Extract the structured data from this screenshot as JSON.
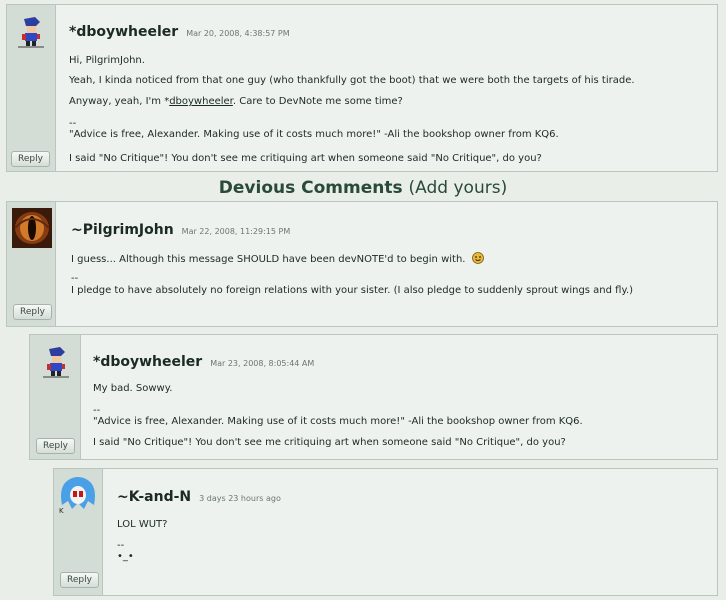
{
  "section_title": "Devious Comments",
  "section_add": "(Add yours)",
  "comments": [
    {
      "author": "*dboywheeler",
      "date": "Mar 20, 2008, 4:38:57 PM",
      "lines": [
        "Hi, PilgrimJohn.",
        "Yeah, I kinda noticed from that one guy (who thankfully got the boot) that we were both the targets of his tirade.",
        "Anyway, yeah, I'm *",
        "dboywheeler",
        ". Care to DevNote me some time?"
      ],
      "sig_sep": "--",
      "sig1": "\"Advice is free, Alexander. Making use of it costs much more!\" -Ali the bookshop owner from KQ6.",
      "sig2": "I said \"No Critique\"! You don't see me critiquing art when someone said \"No Critique\", do you?",
      "reply": "Reply"
    },
    {
      "author": "~PilgrimJohn",
      "date": "Mar 22, 2008, 11:29:15 PM",
      "line1": "I guess... Although this message SHOULD have been devNOTE'd to begin with.",
      "sig_sep": "--",
      "sig1": "I pledge to have absolutely no foreign relations with your sister. (I also pledge to suddenly sprout wings and fly.)",
      "reply": "Reply"
    },
    {
      "author": "*dboywheeler",
      "date": "Mar 23, 2008, 8:05:44 AM",
      "line1": "My bad. Sowwy.",
      "sig_sep": "--",
      "sig1": "\"Advice is free, Alexander. Making use of it costs much more!\" -Ali the bookshop owner from KQ6.",
      "sig2": "I said \"No Critique\"! You don't see me critiquing art when someone said \"No Critique\", do you?",
      "reply": "Reply"
    },
    {
      "author": "~K-and-N",
      "date": "3 days 23 hours ago",
      "line1": "LOL WUT?",
      "sig_sep": "--",
      "sig1": "•_•",
      "reply": "Reply"
    }
  ],
  "avatar_k_letter": "K"
}
